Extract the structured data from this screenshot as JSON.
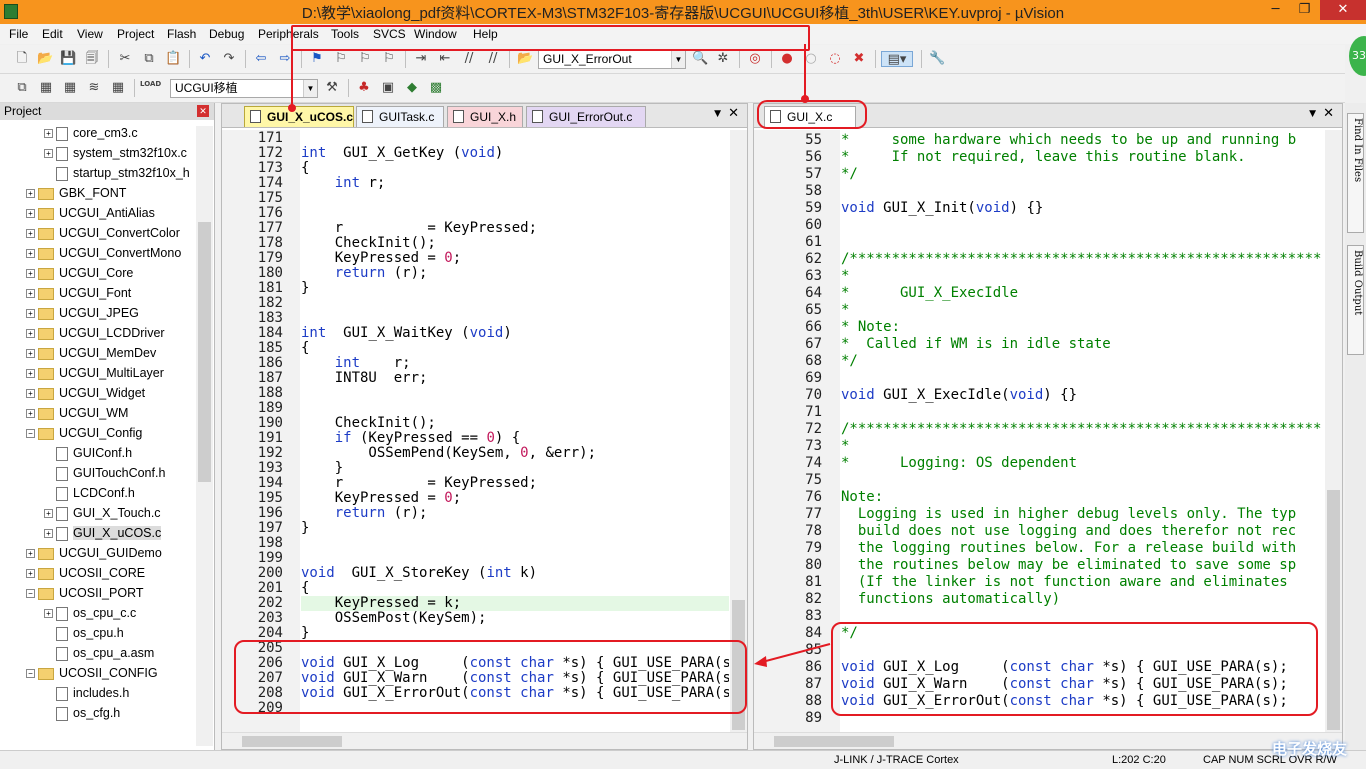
{
  "window": {
    "title": "D:\\教学\\xiaolong_pdf资料\\CORTEX-M3\\STM32F103-寄存器版\\UCGUI\\UCGUI移植_3th\\USER\\KEY.uvproj - µVision",
    "min": "─",
    "max": "❐",
    "close": "✕"
  },
  "menu": [
    "File",
    "Edit",
    "View",
    "Project",
    "Flash",
    "Debug",
    "Peripherals",
    "Tools",
    "SVCS",
    "Window",
    "Help"
  ],
  "toolbar": {
    "function_combo": "GUI_X_ErrorOut",
    "target_combo": "UCGUI移植",
    "load_label": "LOAD"
  },
  "project": {
    "title": "Project",
    "items": [
      {
        "label": "core_cm3.c",
        "type": "file",
        "exp": "+",
        "depth": 2
      },
      {
        "label": "system_stm32f10x.c",
        "type": "file",
        "exp": "+",
        "depth": 2
      },
      {
        "label": "startup_stm32f10x_h",
        "type": "file",
        "exp": "",
        "depth": 2
      },
      {
        "label": "GBK_FONT",
        "type": "folder",
        "exp": "+",
        "depth": 1
      },
      {
        "label": "UCGUI_AntiAlias",
        "type": "folder",
        "exp": "+",
        "depth": 1
      },
      {
        "label": "UCGUI_ConvertColor",
        "type": "folder",
        "exp": "+",
        "depth": 1
      },
      {
        "label": "UCGUI_ConvertMono",
        "type": "folder",
        "exp": "+",
        "depth": 1
      },
      {
        "label": "UCGUI_Core",
        "type": "folder",
        "exp": "+",
        "depth": 1
      },
      {
        "label": "UCGUI_Font",
        "type": "folder",
        "exp": "+",
        "depth": 1
      },
      {
        "label": "UCGUI_JPEG",
        "type": "folder",
        "exp": "+",
        "depth": 1
      },
      {
        "label": "UCGUI_LCDDriver",
        "type": "folder",
        "exp": "+",
        "depth": 1
      },
      {
        "label": "UCGUI_MemDev",
        "type": "folder",
        "exp": "+",
        "depth": 1
      },
      {
        "label": "UCGUI_MultiLayer",
        "type": "folder",
        "exp": "+",
        "depth": 1
      },
      {
        "label": "UCGUI_Widget",
        "type": "folder",
        "exp": "+",
        "depth": 1
      },
      {
        "label": "UCGUI_WM",
        "type": "folder",
        "exp": "+",
        "depth": 1
      },
      {
        "label": "UCGUI_Config",
        "type": "folder",
        "exp": "−",
        "depth": 1
      },
      {
        "label": "GUIConf.h",
        "type": "file",
        "exp": "",
        "depth": 2
      },
      {
        "label": "GUITouchConf.h",
        "type": "file",
        "exp": "",
        "depth": 2
      },
      {
        "label": "LCDConf.h",
        "type": "file",
        "exp": "",
        "depth": 2
      },
      {
        "label": "GUI_X_Touch.c",
        "type": "file",
        "exp": "+",
        "depth": 2
      },
      {
        "label": "GUI_X_uCOS.c",
        "type": "file",
        "exp": "+",
        "depth": 2
      },
      {
        "label": "UCGUI_GUIDemo",
        "type": "folder",
        "exp": "+",
        "depth": 1
      },
      {
        "label": "UCOSII_CORE",
        "type": "folder",
        "exp": "+",
        "depth": 1
      },
      {
        "label": "UCOSII_PORT",
        "type": "folder",
        "exp": "−",
        "depth": 1
      },
      {
        "label": "os_cpu_c.c",
        "type": "file",
        "exp": "+",
        "depth": 2
      },
      {
        "label": "os_cpu.h",
        "type": "file",
        "exp": "",
        "depth": 2
      },
      {
        "label": "os_cpu_a.asm",
        "type": "file",
        "exp": "",
        "depth": 2
      },
      {
        "label": "UCOSII_CONFIG",
        "type": "folder",
        "exp": "−",
        "depth": 1
      },
      {
        "label": "includes.h",
        "type": "file",
        "exp": "",
        "depth": 2
      },
      {
        "label": "os_cfg.h",
        "type": "file",
        "exp": "",
        "depth": 2
      }
    ]
  },
  "left_editor": {
    "tabs": [
      "GUI_X_uCOS.c",
      "GUITask.c",
      "GUI_X.h",
      "GUI_ErrorOut.c"
    ],
    "first_line": 171,
    "lines": [
      "",
      "int  GUI_X_GetKey (void)",
      "{",
      "    int r;",
      "",
      "",
      "    r          = KeyPressed;",
      "    CheckInit();",
      "    KeyPressed = 0;",
      "    return (r);",
      "}",
      "",
      "",
      "int  GUI_X_WaitKey (void)",
      "{",
      "    int    r;",
      "    INT8U  err;",
      "",
      "",
      "    CheckInit();",
      "    if (KeyPressed == 0) {",
      "        OSSemPend(KeySem, 0, &err);",
      "    }",
      "    r          = KeyPressed;",
      "    KeyPressed = 0;",
      "    return (r);",
      "}",
      "",
      "",
      "void  GUI_X_StoreKey (int k)",
      "{",
      "    KeyPressed = k;",
      "    OSSemPost(KeySem);",
      "}",
      "",
      "void GUI_X_Log     (const char *s) { GUI_USE_PARA(s); }",
      "void GUI_X_Warn    (const char *s) { GUI_USE_PARA(s); }",
      "void GUI_X_ErrorOut(const char *s) { GUI_USE_PARA(s); }",
      ""
    ]
  },
  "right_editor": {
    "tabs": [
      "GUI_X.c"
    ],
    "first_line": 55,
    "lines": [
      "*     some hardware which needs to be up and running b",
      "*     If not required, leave this routine blank.",
      "*/",
      "",
      "void GUI_X_Init(void) {}",
      "",
      "",
      "/********************************************************",
      "*",
      "*      GUI_X_ExecIdle",
      "*",
      "* Note:",
      "*  Called if WM is in idle state",
      "*/",
      "",
      "void GUI_X_ExecIdle(void) {}",
      "",
      "/********************************************************",
      "*",
      "*      Logging: OS dependent",
      "",
      "Note:",
      "  Logging is used in higher debug levels only. The typ",
      "  build does not use logging and does therefor not rec",
      "  the logging routines below. For a release build with",
      "  the routines below may be eliminated to save some sp",
      "  (If the linker is not function aware and eliminates",
      "  functions automatically)",
      "",
      "*/",
      "",
      "void GUI_X_Log     (const char *s) { GUI_USE_PARA(s);",
      "void GUI_X_Warn    (const char *s) { GUI_USE_PARA(s);",
      "void GUI_X_ErrorOut(const char *s) { GUI_USE_PARA(s);",
      ""
    ]
  },
  "side_tabs": [
    "Find In Files",
    "Build Output"
  ],
  "status": {
    "debugger": "J-LINK / J-TRACE Cortex",
    "position": "L:202 C:20",
    "caps": "CAP NUM SCRL OVR R/W"
  },
  "watermark": "电子发烧友"
}
